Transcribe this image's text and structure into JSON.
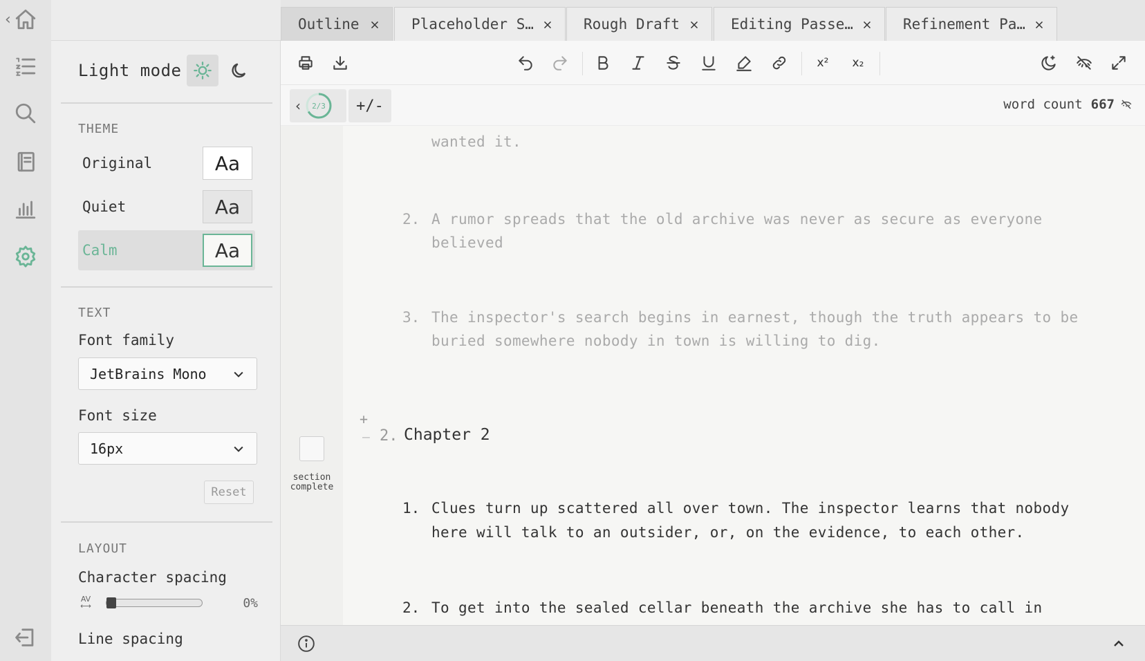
{
  "rail": {
    "items": [
      "home-icon",
      "outline-list-icon",
      "search-icon",
      "notebook-icon",
      "stats-icon",
      "settings-icon",
      "logout-icon"
    ],
    "active": "settings-icon",
    "accent": "#6ab596"
  },
  "settings": {
    "mode_label": "Light mode",
    "theme_title": "THEME",
    "themes": [
      {
        "name": "Original",
        "sample": "Aa"
      },
      {
        "name": "Quiet",
        "sample": "Aa"
      },
      {
        "name": "Calm",
        "sample": "Aa"
      }
    ],
    "selected_theme": "Calm",
    "text_title": "TEXT",
    "font_family_label": "Font family",
    "font_family_value": "JetBrains Mono",
    "font_size_label": "Font size",
    "font_size_value": "16px",
    "reset_label": "Reset",
    "layout_title": "LAYOUT",
    "char_spacing_label": "Character spacing",
    "char_spacing_icon": "AV",
    "char_spacing_value": "0%",
    "line_spacing_label": "Line spacing"
  },
  "tabs": [
    {
      "label": "Outline",
      "active": true
    },
    {
      "label": "Placeholder S…",
      "active": false
    },
    {
      "label": "Rough Draft",
      "active": false
    },
    {
      "label": "Editing Passe…",
      "active": false
    },
    {
      "label": "Refinement Pa…",
      "active": false
    }
  ],
  "toolbar": {
    "superscript": "x²",
    "subscript": "x₂"
  },
  "subbar": {
    "progress": "2/3",
    "progress_fraction": 0.667,
    "diff_label": "+/-",
    "word_count_label": "word count",
    "word_count_value": "667"
  },
  "editor": {
    "prev_item_tail": "wanted it.",
    "items_faded": [
      {
        "num": "2.",
        "lines": [
          "A rumor spreads that the old archive was never as secure as everyone",
          "believed"
        ]
      },
      {
        "num": "3.",
        "lines": [
          "The inspector's search begins in earnest, though the truth appears to be",
          "buried somewhere nobody in town is willing to dig."
        ]
      }
    ],
    "chapter_number": "2.",
    "chapter_title": "Chapter 2",
    "section_complete_label": "section complete",
    "chapter_items": [
      {
        "num": "1.",
        "lines": [
          "Clues turn up scattered all over town. The inspector learns that nobody",
          "here will talk to an outsider, or, on the evidence, to each other."
        ]
      },
      {
        "num": "2.",
        "lines": [
          "To get into the sealed cellar beneath the archive she has to call in"
        ]
      }
    ]
  }
}
